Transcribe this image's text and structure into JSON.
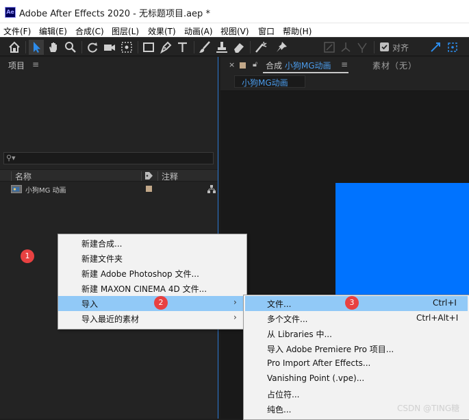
{
  "window": {
    "title": "Adobe After Effects 2020 - 无标题项目.aep *",
    "logo": "Ae"
  },
  "menubar": [
    "文件(F)",
    "编辑(E)",
    "合成(C)",
    "图层(L)",
    "效果(T)",
    "动画(A)",
    "视图(V)",
    "窗口",
    "帮助(H)"
  ],
  "toolbar": {
    "snap_label": "对齐",
    "snap_checked": true
  },
  "project": {
    "tab_label": "项目",
    "search_placeholder": "",
    "columns": {
      "name": "名称",
      "comment": "注释"
    },
    "items": [
      {
        "name": "小狗MG 动画",
        "label_color": "#c2a889"
      }
    ]
  },
  "composition": {
    "tab_prefix": "合成",
    "tab_name": "小狗MG动画",
    "footage_tab": "素材（无）",
    "breadcrumb": "小狗MG动画",
    "canvas_color": "#0073ff"
  },
  "context_menu": [
    {
      "label": "新建合成..."
    },
    {
      "label": "新建文件夹"
    },
    {
      "label": "新建 Adobe Photoshop 文件..."
    },
    {
      "label": "新建 MAXON CINEMA 4D 文件..."
    },
    {
      "label": "导入",
      "submenu": true,
      "highlighted": true
    },
    {
      "label": "导入最近的素材",
      "submenu": true
    }
  ],
  "import_submenu": [
    {
      "label": "文件...",
      "shortcut": "Ctrl+I",
      "highlighted": true
    },
    {
      "label": "多个文件...",
      "shortcut": "Ctrl+Alt+I"
    },
    {
      "label": "从 Libraries 中..."
    },
    {
      "label": "导入 Adobe Premiere Pro 项目..."
    },
    {
      "label": "Pro Import After Effects..."
    },
    {
      "label": "Vanishing Point (.vpe)..."
    },
    {
      "label": "占位符..."
    },
    {
      "label": "纯色..."
    }
  ],
  "annotations": [
    "1",
    "2",
    "3"
  ],
  "watermark": "CSDN @TING糖"
}
